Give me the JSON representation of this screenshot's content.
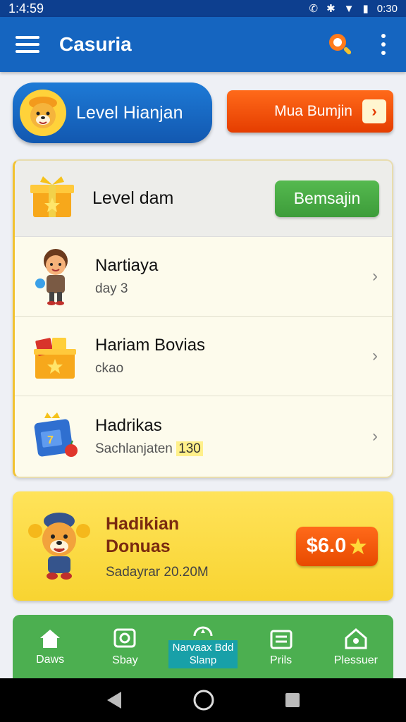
{
  "status_bar": {
    "time_left": "1:4:59",
    "time_right": "0:30"
  },
  "app_bar": {
    "title": "Casuria"
  },
  "top_buttons": {
    "level_pill_label": "Level Hianjan",
    "orange_button_label": "Mua Bumjin",
    "orange_button_arrow": "›"
  },
  "card": {
    "header_title": "Level dam",
    "header_button_label": "Bemsajin",
    "items": [
      {
        "title": "Nartiaya",
        "subtitle": "day 3",
        "highlight": ""
      },
      {
        "title": "Hariam Bovias",
        "subtitle": "ckao",
        "highlight": ""
      },
      {
        "title": "Hadrikas",
        "subtitle": "Sachlanjaten",
        "highlight": "130"
      }
    ]
  },
  "bonus": {
    "title_line1": "Hadikian",
    "title_line2": "Donuas",
    "subtitle": "Sadayrar 20.20M",
    "price": "$6.0",
    "price_icon": "star-icon"
  },
  "bottom_nav": {
    "items": [
      {
        "label": "Daws",
        "icon": "home-icon"
      },
      {
        "label": "Sbay",
        "icon": "chat-icon"
      },
      {
        "label_line1": "Narvaax Bdd",
        "label_line2": "Slanp",
        "icon": "compass-icon"
      },
      {
        "label": "Prils",
        "icon": "list-icon"
      },
      {
        "label": "Plessuer",
        "icon": "house-outline-icon"
      }
    ]
  },
  "colors": {
    "app_bar": "#1565c0",
    "accent_orange": "#e53d00",
    "accent_green": "#4caf50",
    "bonus_yellow": "#f8d431"
  }
}
